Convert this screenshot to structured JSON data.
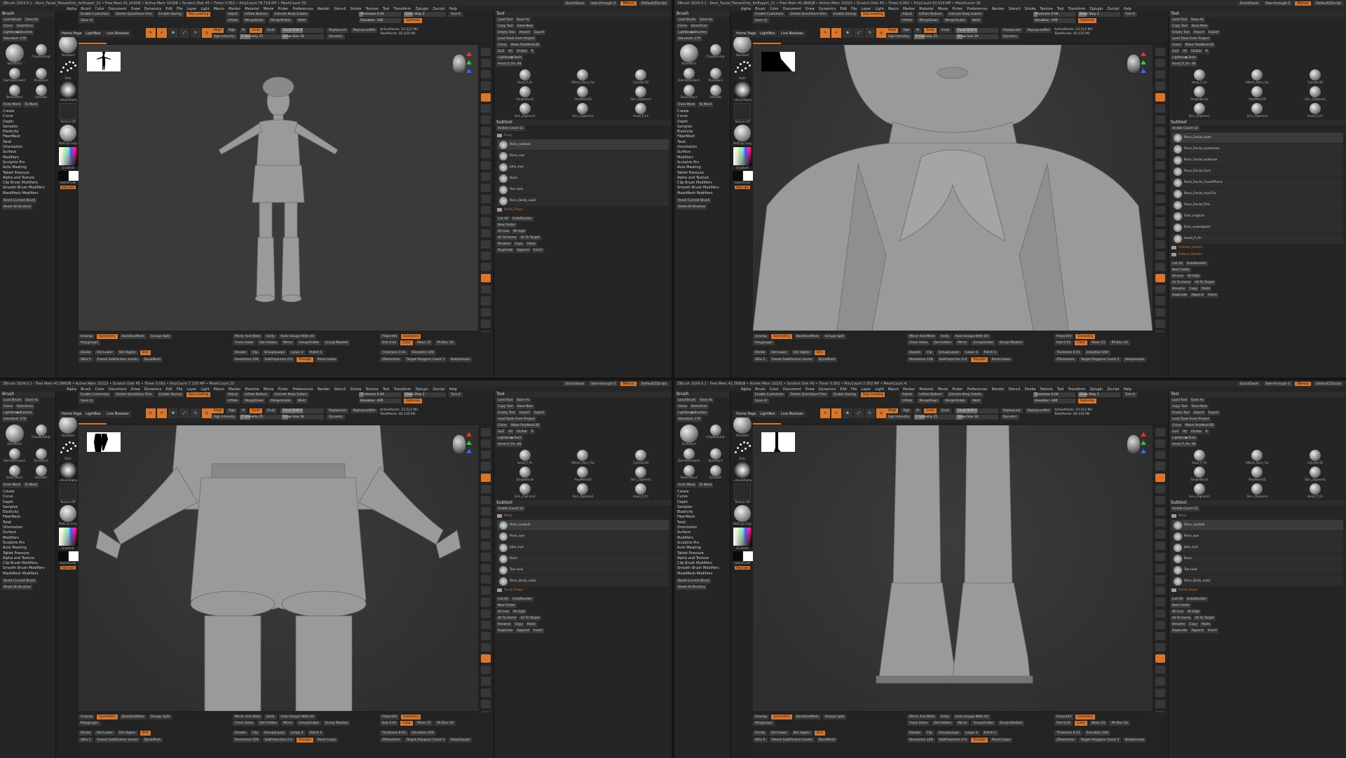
{
  "panes": [
    {
      "title": "ZBrush 2024.0.1 - Rons_Facial_PiecesOnly_forExport_21 • Free Mem 41.243GB • Active Mem 10188 • Scratch Disk 45 • Timer 0.052 • PolyCount 78.719 MP • MeshCount 59",
      "view": "full",
      "tool_mode": "tool",
      "left_header": "Brush"
    },
    {
      "title": "ZBrush 2024.0.1 - Rons_Facial_PiecesOnly_forExport_21 • Free Mem 41.469GB • Active Mem 10223 • Scratch Disk 45 • Timer 0.002 • PolyCount 63.519 MP • MeshCount 30",
      "view": "face",
      "tool_mode": "subtool",
      "left_header": "Brush"
    },
    {
      "title": "ZBrush 2024.0.1 - Free Mem 41.586GB • Active Mem 10223 • Scratch Disk 45 • Timer 0.002 • PolyCount 7.320 MP • MeshCount 25",
      "view": "torso",
      "tool_mode": "subtool",
      "left_header": "Brush"
    },
    {
      "title": "ZBrush 2024.0.1 - Free Mem 41.569GB • Active Mem 10191 • Scratch Disk 45 • Timer 0.002 • PolyCount 2.502 MP • MeshCount 4",
      "view": "boots",
      "tool_mode": "subtool",
      "left_header": "Brush"
    }
  ],
  "titlebar": {
    "quicksave": "QuickSave",
    "seethrough": "See-through 0",
    "menus": "Menus",
    "script": "DefaultZScript"
  },
  "menubar": [
    "Alpha",
    "Brush",
    "Color",
    "Document",
    "Draw",
    "Dynamics",
    "Edit",
    "File",
    "Layer",
    "Light",
    "Macro",
    "Marker",
    "Material",
    "Movie",
    "Picker",
    "Preferences",
    "Render",
    "Stencil",
    "Stroke",
    "Texture",
    "Tool",
    "Transform",
    "Zplugin",
    "Zscript",
    "Help"
  ],
  "left": {
    "buttons_row1": [
      "Load Brush",
      "Save As"
    ],
    "buttons_row2": [
      "Clone",
      "SelectIcon"
    ],
    "buttons_row3": [
      "Lightbox▶Brushes"
    ],
    "standard_label": "Standard: 179",
    "brushes": [
      "Standard",
      "ClayBuildup",
      "DamStandard",
      "Standard",
      "SelectRect",
      "Smooth"
    ],
    "from_mesh": "From Mesh",
    "to_mesh": "To Mesh",
    "menus": [
      "Create",
      "Curve",
      "Depth",
      "Samples",
      "Elasticity",
      "FiberMesh",
      "Twist",
      "Orientation",
      "Surface",
      "Modifiers",
      "Sculptris Pro",
      "Auto Masking",
      "Tablet Pressure",
      "Alpha and Texture",
      "Clip Brush Modifiers",
      "Smooth Brush Modifiers",
      "MaskMesh Modifiers"
    ],
    "reset_current": "Reset Current Brush",
    "reset_all": "Reset All Brushes"
  },
  "strip": {
    "standard": "Standard",
    "dots": "Dots",
    "alpha": "~BrushAlpha",
    "texture": "Texture Off",
    "matcap": "MatCap Gray",
    "gradient": "Gradient",
    "switch": "SwitchColor",
    "alternate": "Alternate"
  },
  "shelf": {
    "enable_customize": "Enable Customize",
    "delete_quicksave": "Delete QuickSave Files",
    "enable_saving": "Enable Saving",
    "skip_loading": "Skip Loading",
    "save_ui": "Save Ui",
    "home_page": "Home Page",
    "lightbox": "LightBox",
    "live_boolean": "Live Boolean",
    "edit": "Edit",
    "draw": "Draw",
    "move": "Move",
    "scale": "Scale",
    "rotate": "Rotate",
    "mrgb": "Mrgb",
    "rgb": "Rgb",
    "m": "M",
    "zadd": "Zadd",
    "zsub": "Zsub",
    "zcut": "Zcut",
    "rgb_intensity": "Rgb Intensity",
    "z_intensity": "Z Intensity 25",
    "focal_shift": "Focal Shift 0",
    "draw_size": "Draw Size 16",
    "dynamic": "Dynamic",
    "replay_last": "ReplayLast",
    "replay_last_rel": "ReplayLastRel",
    "active_points": "ActivePoints: 23.512 Mil",
    "total_points": "TotalPoints: 85.435 Mil",
    "adjust": "Adjust",
    "inflate_balloon": "Inflate Balloon",
    "inflate": "Inflate",
    "weld": "Weld",
    "extrude_keep": "Extrude Keep Subdiv",
    "merge_down": "MergeDown",
    "merge_visible": "MergeVisible",
    "thickness": "Thickness 0.04",
    "elevation": "Elevation -100",
    "grow_step": "Grow Step 2",
    "optimize": "Optimize",
    "turn_it": "Turn It"
  },
  "tool": {
    "header": "Tool",
    "load_tool": "Load Tool",
    "save_as": "Save As",
    "copy_tool": "Copy Tool",
    "save_new": "Save New",
    "empty_tool": "Empty Tool",
    "import": "Import",
    "export": "Export",
    "load_from_project": "Load Tools From Project",
    "clone": "Clone",
    "make_polymesh": "Make PolyMesh3D",
    "goz": "GoZ",
    "all": "All",
    "visible": "Visible",
    "r": "R",
    "lightbox_tools": "Lightbox▶Tools",
    "current_tool": "Head_P_fin: 48",
    "tools": [
      "Head_P_fin",
      "UMesh_Rons_Fac",
      "Cylinder3D",
      "SimpleBrush",
      "PolyMesh3D",
      "Skin_ZSphere1",
      "Skin_ZSphere2",
      "Skin_ZSphere3",
      "Head_P_fin"
    ],
    "subtool": "Subtool",
    "visible_count": "Visible Count 12",
    "subtools": [
      "Rons_Facial_eyes",
      "Rons_Facial_eyelashes",
      "Rons_Facial_eyebrow",
      "Rons_Facial_Face",
      "Rons_Facial_mouthPiece",
      "Rons_Facial_noseTip",
      "Rons_Facial_Pins",
      "Ears_original",
      "Ears_unwrapped",
      "Head_P_fin"
    ],
    "folders": [
      "Clothes_Details",
      "Ribbon_Details",
      "Body",
      "Facial_Props"
    ],
    "subtools_body": [
      "Rons_eyeball",
      "Rons_eye",
      "Jake_eye",
      "Back",
      "Toe nails",
      "Rons_Body_sub2"
    ],
    "list_all": "List All",
    "new_folder": "New Folder",
    "auto_reorder": "AutoReorder",
    "all_low": "All Low",
    "all_high": "All High",
    "all_to_home": "All To Home",
    "all_to_target": "All To Target",
    "rename": "Rename",
    "copy": "Copy",
    "paste": "Paste",
    "append": "Append",
    "duplicate": "Duplicate",
    "insert": "Insert"
  },
  "bottom": {
    "unwrap": "Unwrap",
    "symmetry": "Symmetry",
    "polygroups": "Polygroups",
    "backface_mask": "BackfaceMask",
    "groups_split": "Groups Split",
    "mirror_weld": "Mirror And Weld",
    "unify": "Unify",
    "auto_groups_uv": "Auto Groups With UV",
    "project_all": "ProjectAll",
    "geometry": "Geometry",
    "zremesher": "ZRemesher",
    "divide": "Divide",
    "del_lower": "Del Lower",
    "del_higher": "Del Higher",
    "close_holes": "Close Holes",
    "del_hidden": "Del Hidden",
    "mirror": "Mirror",
    "group_visible": "GroupVisible",
    "group_masked": "Group Masked",
    "dist": "Dist 0.02",
    "color": "Color",
    "smt": "Smt",
    "double": "Double",
    "flip": "Flip",
    "groups_loops": "GroupsLoops",
    "loops": "Loops 4",
    "polish": "Polish 5",
    "thickness": "Thickness 0.01",
    "panel_loops": "Panel Loops",
    "elevation": "Elevation 100",
    "target_polygons": "Target Polygons Count 5",
    "keep_groups": "KeepGroups",
    "sdiv": "SDiv 5",
    "freeze_subdiv": "Freeze SubDivision Levels",
    "resolution": "Resolution 128",
    "subprojection": "SubProjection 0.6",
    "triangle": "Triangle",
    "dynamesh": "DynaMesh",
    "mean": "Mean 25",
    "pa_blur": "PA Blur 10"
  },
  "colors": {
    "accent": "#d9762a",
    "panel": "#252525",
    "viewport": "#3a3a3a",
    "model": "#9a9a9a"
  },
  "icons": [
    "lightbox-icon",
    "edit-icon",
    "draw-icon",
    "move-icon",
    "scale-icon",
    "rotate-icon",
    "navigation-head-icon",
    "axis-gizmo-icon"
  ]
}
